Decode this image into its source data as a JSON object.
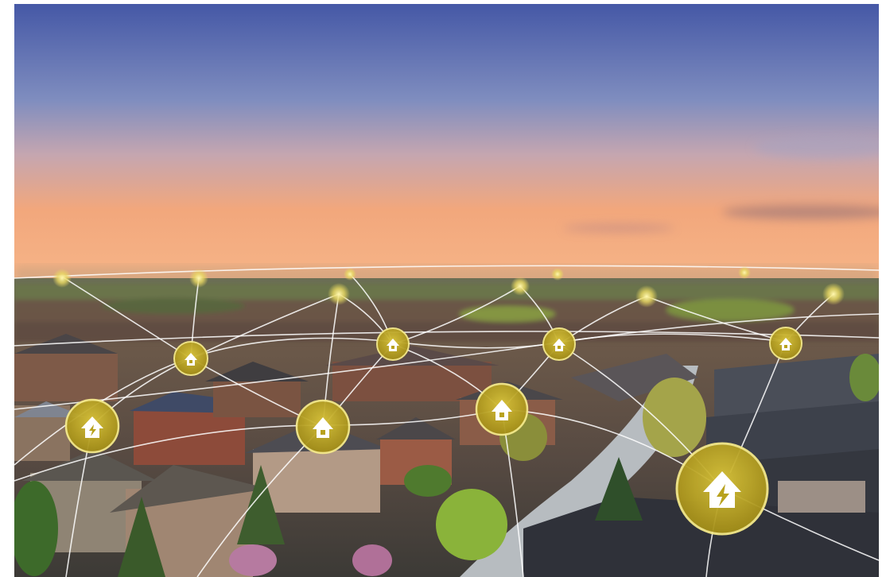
{
  "image": {
    "subject": "aerial-suburb-smart-grid",
    "icons": [
      "house-icon",
      "house-lightning-icon"
    ],
    "colors": {
      "sky_top": "#4a5ea8",
      "sky_mid": "#9fa6c8",
      "sky_sunset": "#f0a878",
      "horizon": "#f5b98a",
      "node": "#b8a21e",
      "node_glow": "#f1e27a",
      "grid_line": "#ffffff",
      "road": "#b9bfc4",
      "roof_dark": "#3a3d45",
      "brick": "#8a5a44",
      "tree": "#4d7a2e"
    }
  }
}
